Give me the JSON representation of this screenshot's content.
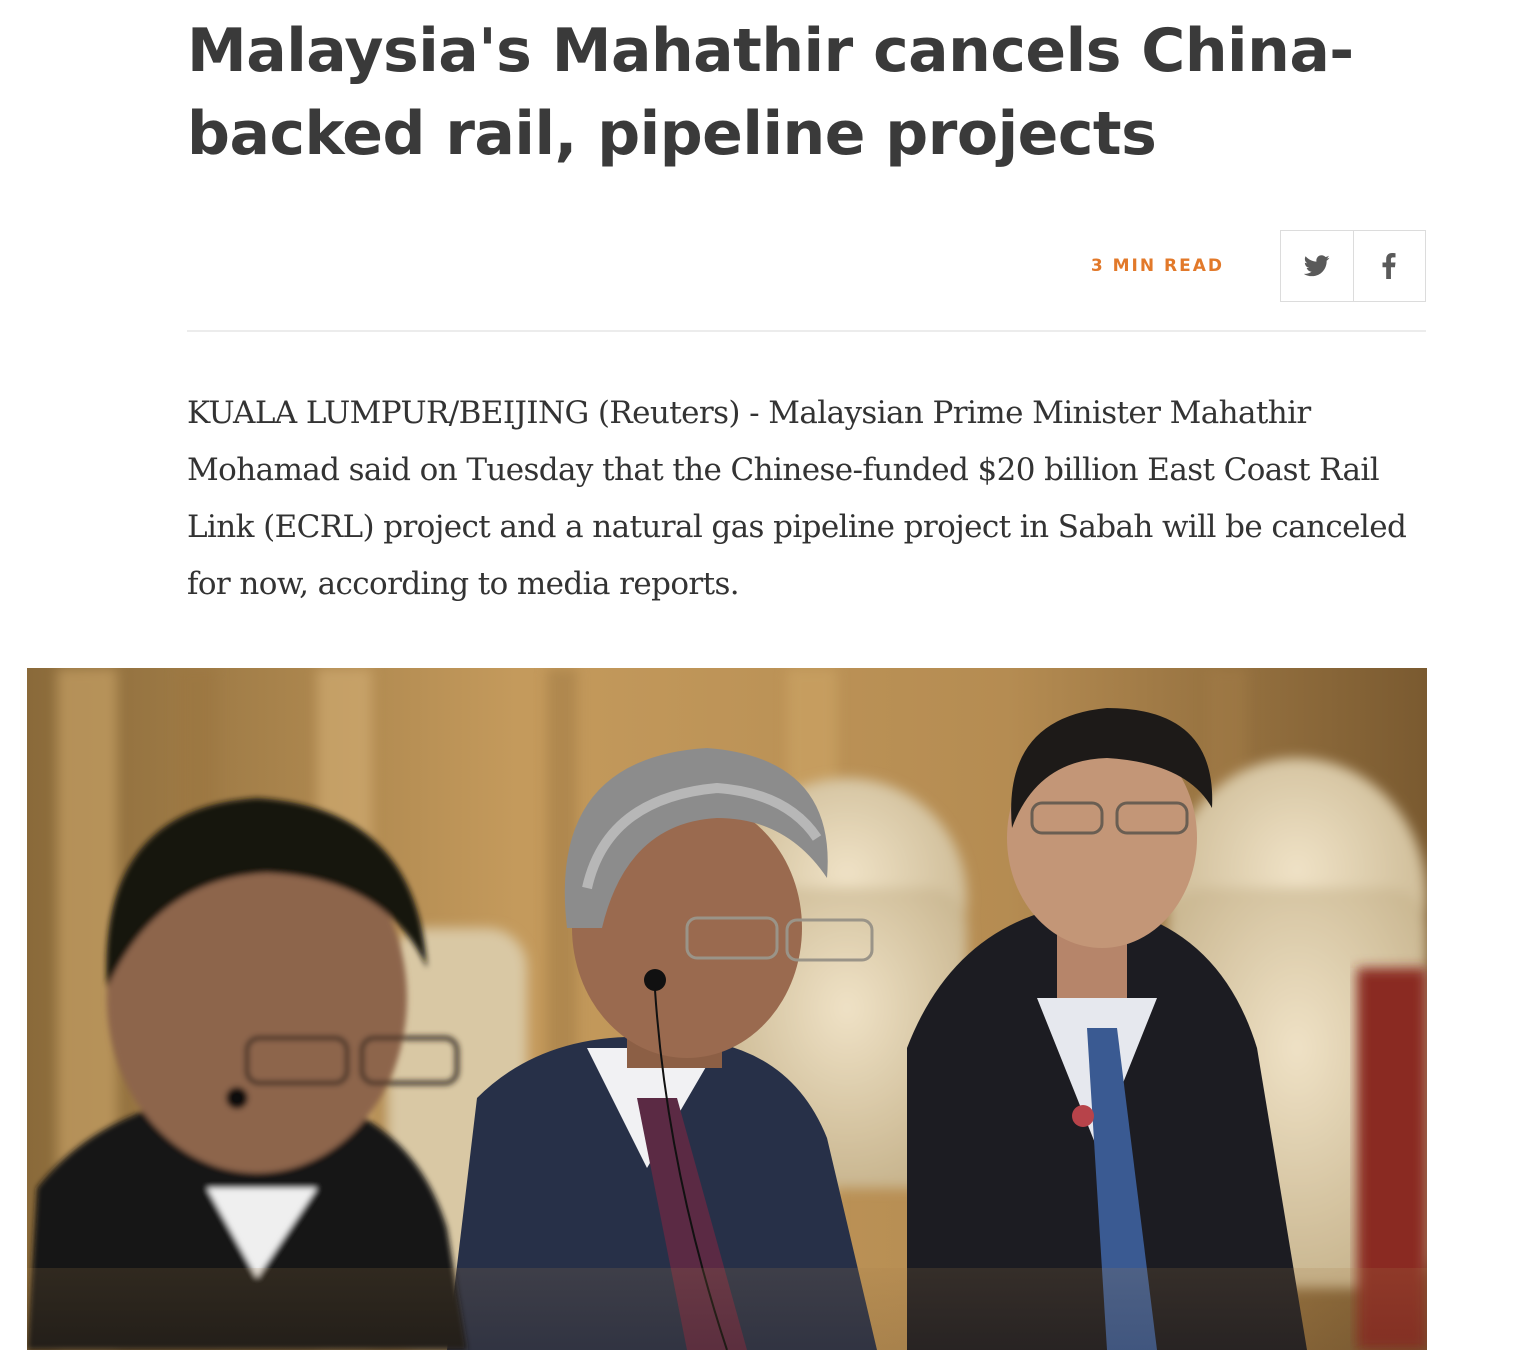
{
  "article": {
    "headline": "Malaysia's Mahathir cancels China-backed rail, pipeline projects",
    "read_time": "3 MIN READ",
    "lede": "KUALA LUMPUR/BEIJING (Reuters) - Malaysian Prime Minister Mahathir Mohamad said on Tuesday that the Chinese-funded $20 billion East Coast Rail Link (ECRL) project and a natural gas pipeline project in Sabah will be canceled for now, according to media reports."
  },
  "share": {
    "buttons": [
      {
        "icon": "twitter-icon"
      },
      {
        "icon": "facebook-icon"
      }
    ]
  },
  "colors": {
    "headline": "#3a3a3a",
    "accent": "#e2792a",
    "body_text": "#333333",
    "divider": "#ececec",
    "icon": "#5a5a5a"
  },
  "photo": {
    "content": "Three men in suits seated in beige armchairs wearing interpretation earpieces"
  }
}
